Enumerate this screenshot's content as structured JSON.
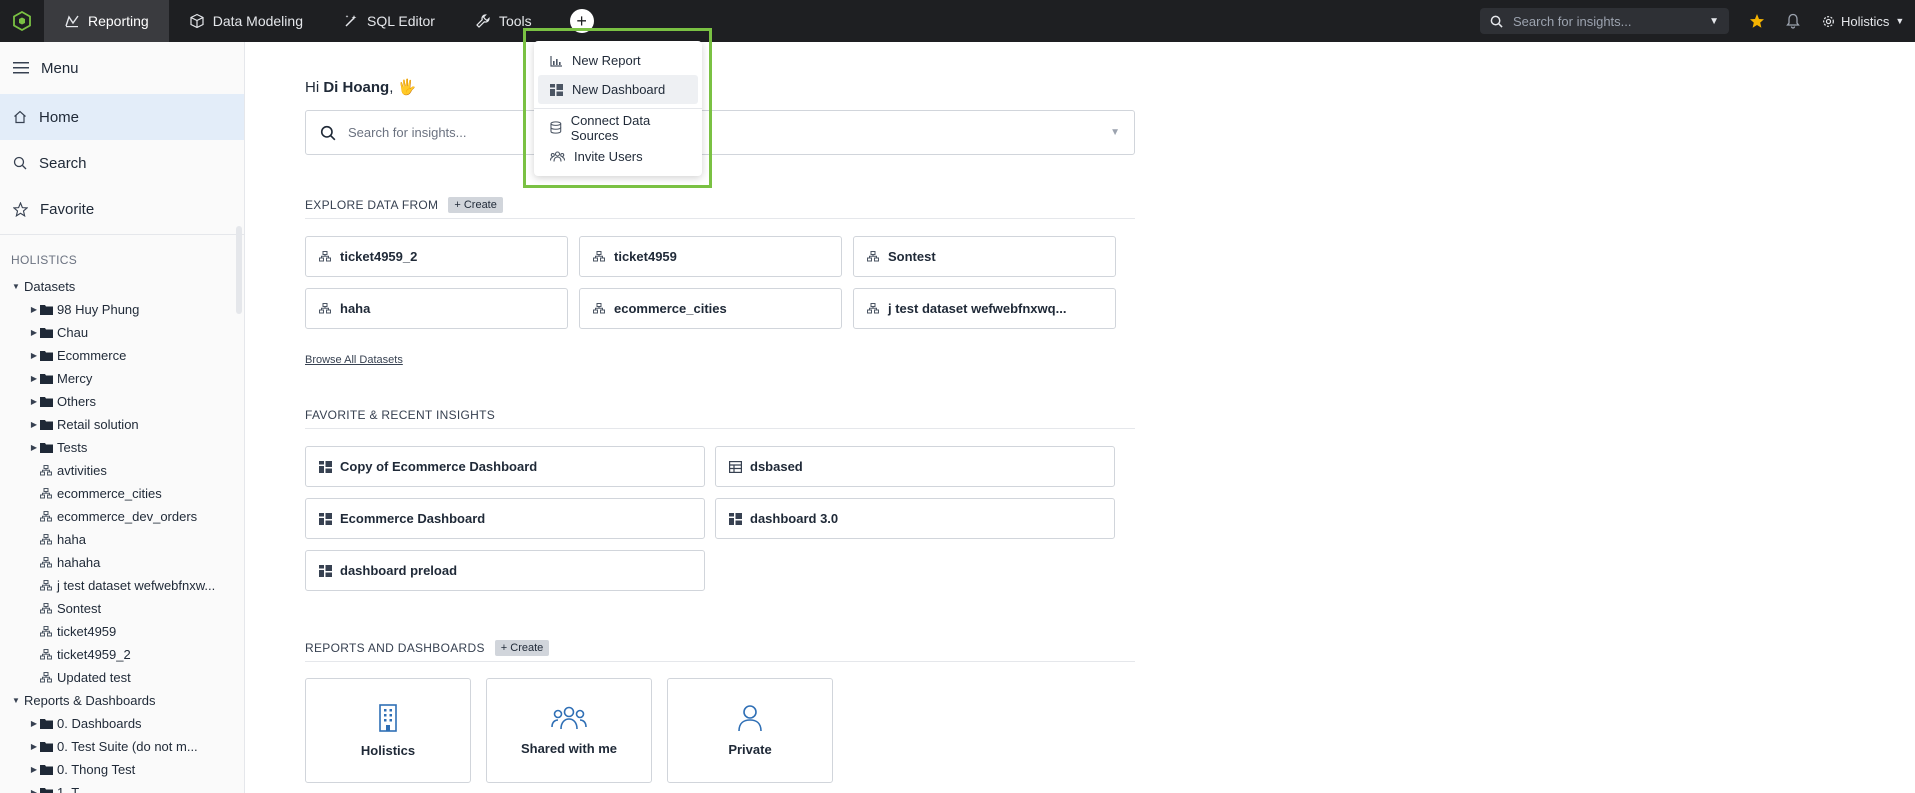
{
  "topbar": {
    "tabs": [
      {
        "label": "Reporting",
        "icon": "reporting-icon",
        "active": true
      },
      {
        "label": "Data Modeling",
        "icon": "cube-icon",
        "active": false
      },
      {
        "label": "SQL Editor",
        "icon": "wand-icon",
        "active": false
      },
      {
        "label": "Tools",
        "icon": "wrench-icon",
        "active": false
      }
    ],
    "plus_label": "+",
    "search_placeholder": "Search for insights...",
    "workspace": "Holistics"
  },
  "dropdown": {
    "items": [
      {
        "label": "New Report",
        "icon": "chart-icon"
      },
      {
        "label": "New Dashboard",
        "icon": "dashboard-icon"
      },
      {
        "label": "Connect Data Sources",
        "icon": "database-icon"
      },
      {
        "label": "Invite Users",
        "icon": "users-icon"
      }
    ]
  },
  "sidebar": {
    "menu": "Menu",
    "home": "Home",
    "search": "Search",
    "favorite": "Favorite",
    "section": "HOLISTICS",
    "datasets_label": "Datasets",
    "dataset_folders": [
      "98 Huy Phung",
      "Chau",
      "Ecommerce",
      "Mercy",
      "Others",
      "Retail solution",
      "Tests"
    ],
    "datasets": [
      "avtivities",
      "ecommerce_cities",
      "ecommerce_dev_orders",
      "haha",
      "hahaha",
      "j test dataset wefwebfnxw...",
      "Sontest",
      "ticket4959",
      "ticket4959_2",
      "Updated test"
    ],
    "reports_label": "Reports & Dashboards",
    "report_folders": [
      "0. Dashboards",
      "0. Test Suite (do not m...",
      "0. Thong Test",
      "1. T"
    ]
  },
  "main": {
    "greeting_prefix": "Hi ",
    "user_name": "Di Hoang",
    "greeting_suffix": ", 🖐",
    "search_placeholder": "Search for insights...",
    "explore_title": "EXPLORE DATA FROM",
    "create_label": "+ Create",
    "explore_cards": [
      "ticket4959_2",
      "ticket4959",
      "Sontest",
      "haha",
      "ecommerce_cities",
      "j test dataset wefwebfnxwq..."
    ],
    "browse_all": "Browse All Datasets",
    "favorite_title": "FAVORITE & RECENT INSIGHTS",
    "favorite_cards": [
      {
        "label": "Copy of Ecommerce Dashboard",
        "icon": "dashboard-icon"
      },
      {
        "label": "dsbased",
        "icon": "table-icon"
      },
      {
        "label": "Ecommerce Dashboard",
        "icon": "dashboard-icon"
      },
      {
        "label": "dashboard 3.0",
        "icon": "dashboard-icon"
      },
      {
        "label": "dashboard preload",
        "icon": "dashboard-icon"
      }
    ],
    "reports_title": "REPORTS AND DASHBOARDS",
    "folders": [
      {
        "label": "Holistics",
        "icon": "building-icon"
      },
      {
        "label": "Shared with me",
        "icon": "users-icon"
      },
      {
        "label": "Private",
        "icon": "user-icon"
      }
    ]
  },
  "colors": {
    "accent": "#7ac143",
    "topbar": "#1e1f22",
    "folder_icon": "#2f6fb5",
    "star": "#f5b301"
  }
}
